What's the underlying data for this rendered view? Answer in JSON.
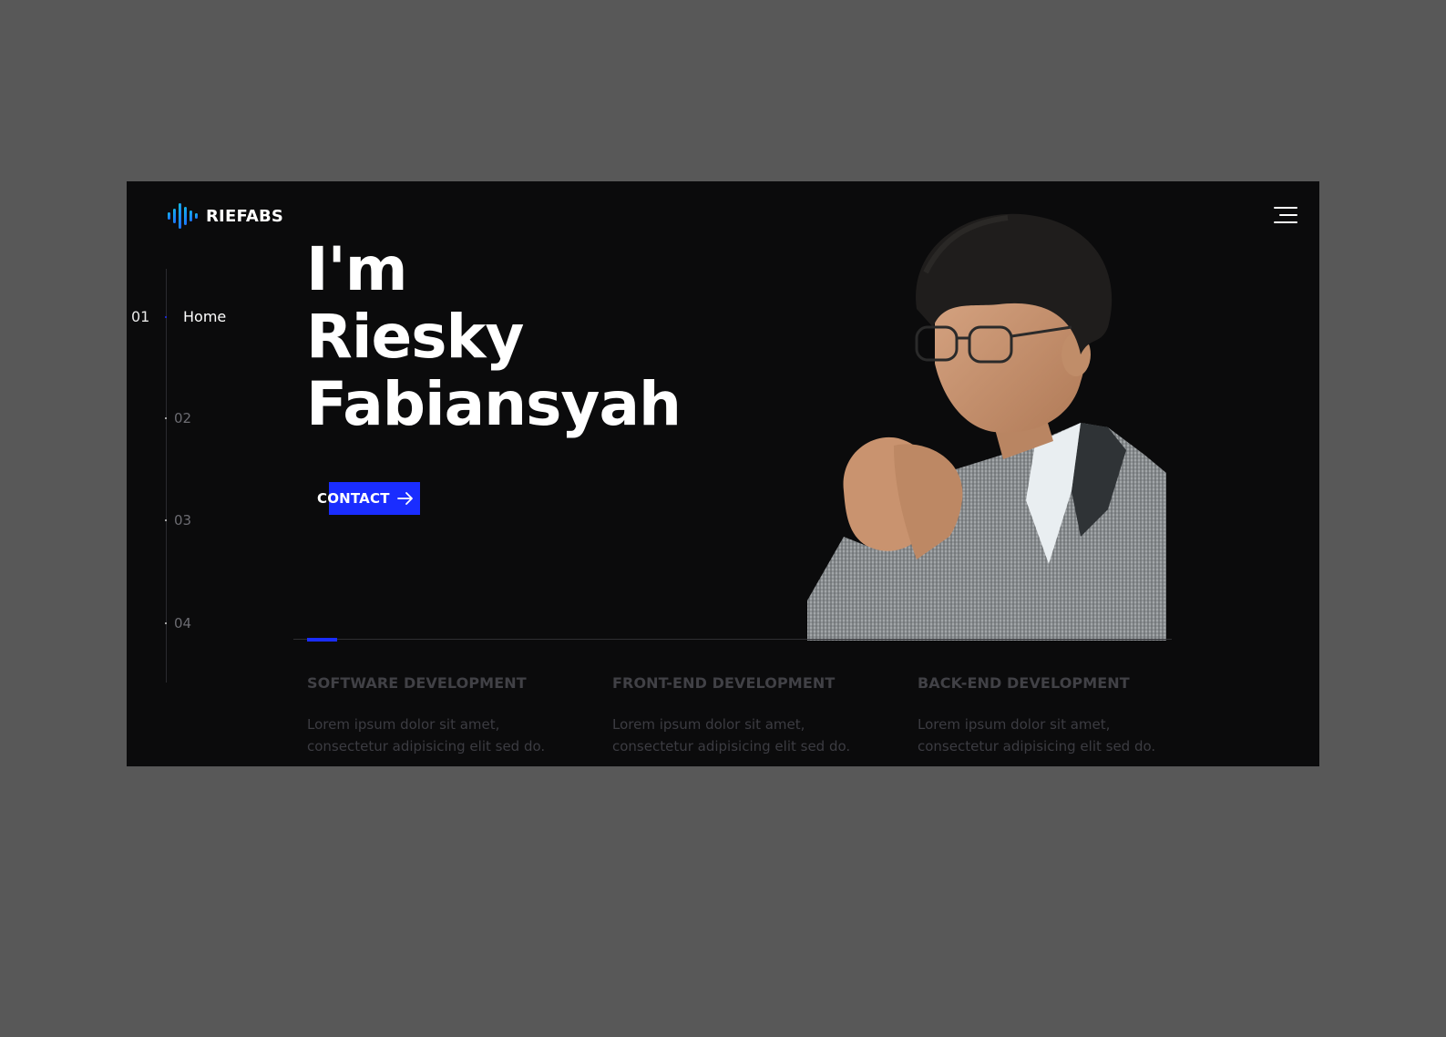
{
  "brand": {
    "name": "RIEFABS",
    "logo_icon": "sound-wave-icon"
  },
  "menu": {
    "icon": "hamburger-menu-icon"
  },
  "side_nav": {
    "active_number": "01",
    "active_label": "Home",
    "items": [
      {
        "number": "02"
      },
      {
        "number": "03"
      },
      {
        "number": "04"
      }
    ]
  },
  "hero": {
    "line1": "I'm",
    "line2": "Riesky",
    "line3": "Fabiansyah",
    "cta_label": "CONTACT",
    "cta_icon": "arrow-right-icon"
  },
  "services": [
    {
      "title": "SOFTWARE DEVELOPMENT",
      "line1": "Lorem ipsum dolor sit amet,",
      "line2": "consectetur adipisicing elit sed do."
    },
    {
      "title": "FRONT-END DEVELOPMENT",
      "line1": "Lorem ipsum dolor sit amet,",
      "line2": "consectetur adipisicing elit sed do."
    },
    {
      "title": "BACK-END DEVELOPMENT",
      "line1": "Lorem ipsum dolor sit amet,",
      "line2": "consectetur adipisicing elit sed do."
    }
  ],
  "colors": {
    "page_background": "#585858",
    "frame_background": "#0b0b0c",
    "accent": "#1a2dff",
    "logo_gradient_start": "#13c7e0",
    "logo_gradient_end": "#1f5bff"
  }
}
